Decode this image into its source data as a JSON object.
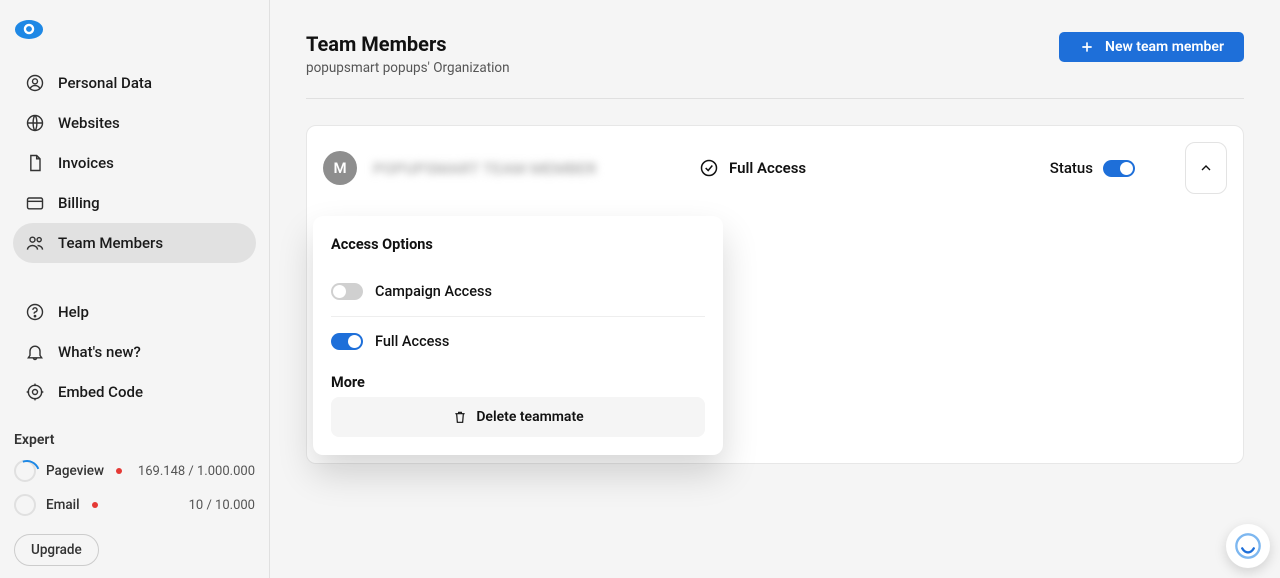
{
  "sidebar": {
    "items": [
      {
        "label": "Personal Data"
      },
      {
        "label": "Websites"
      },
      {
        "label": "Invoices"
      },
      {
        "label": "Billing"
      },
      {
        "label": "Team Members"
      }
    ],
    "footerItems": [
      {
        "label": "Help"
      },
      {
        "label": "What's new?"
      },
      {
        "label": "Embed Code"
      }
    ],
    "expert": {
      "heading": "Expert",
      "pageview": {
        "label": "Pageview",
        "value": "169.148 / 1.000.000"
      },
      "email": {
        "label": "Email",
        "value": "10 / 10.000"
      },
      "upgradeLabel": "Upgrade"
    }
  },
  "header": {
    "title": "Team Members",
    "subtitle": "popupsmart popups' Organization",
    "newButton": "New team member"
  },
  "member": {
    "avatarLetter": "M",
    "name": "POPUPSMART TEAM MEMBER",
    "accessLevel": "Full Access",
    "statusLabel": "Status"
  },
  "dropdown": {
    "heading": "Access Options",
    "campaignAccess": "Campaign Access",
    "fullAccess": "Full Access",
    "moreHeading": "More",
    "deleteLabel": "Delete teammate"
  }
}
